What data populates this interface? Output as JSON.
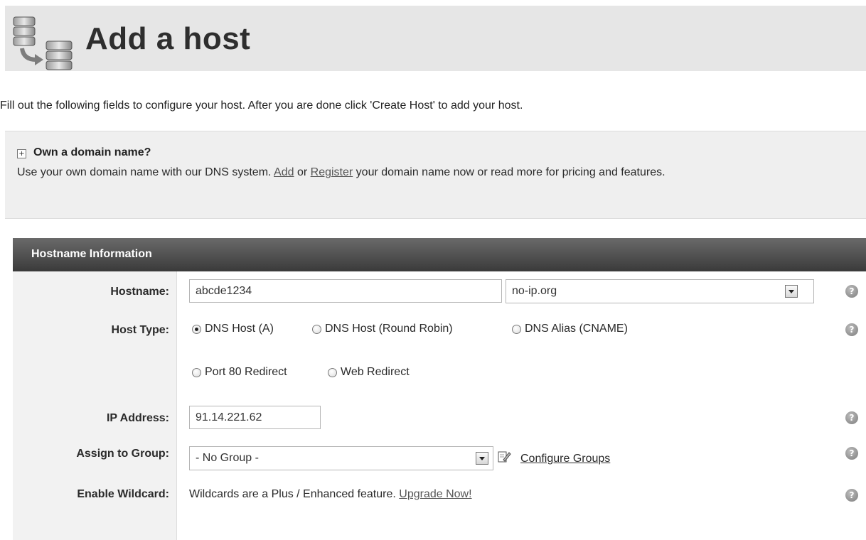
{
  "header": {
    "title": "Add a host",
    "icon": "servers-icon"
  },
  "intro": "Fill out the following fields to configure your host. After you are done click 'Create Host' to add your host.",
  "notice": {
    "title": "Own a domain name?",
    "text_before": "Use your own domain name with our DNS system.",
    "add_link": "Add",
    "or": "or",
    "register_link": "Register",
    "text_after": "your domain name now or read more for pricing and features."
  },
  "panel": {
    "title": "Hostname Information",
    "hostname": {
      "label": "Hostname:",
      "value": "abcde1234",
      "domain": "no-ip.org"
    },
    "host_type": {
      "label": "Host Type:",
      "options": [
        {
          "label": "DNS Host (A)",
          "checked": true
        },
        {
          "label": "DNS Host (Round Robin)",
          "checked": false
        },
        {
          "label": "DNS Alias (CNAME)",
          "checked": false
        },
        {
          "label": "Port 80 Redirect",
          "checked": false
        },
        {
          "label": "Web Redirect",
          "checked": false
        }
      ]
    },
    "ip_address": {
      "label": "IP Address:",
      "value": "91.14.221.62"
    },
    "group": {
      "label": "Assign to Group:",
      "value": "- No Group -",
      "configure_link": "Configure Groups"
    },
    "wildcard": {
      "label": "Enable Wildcard:",
      "text": "Wildcards are a Plus / Enhanced feature.",
      "upgrade_link": "Upgrade Now!"
    },
    "help_glyph": "?"
  }
}
